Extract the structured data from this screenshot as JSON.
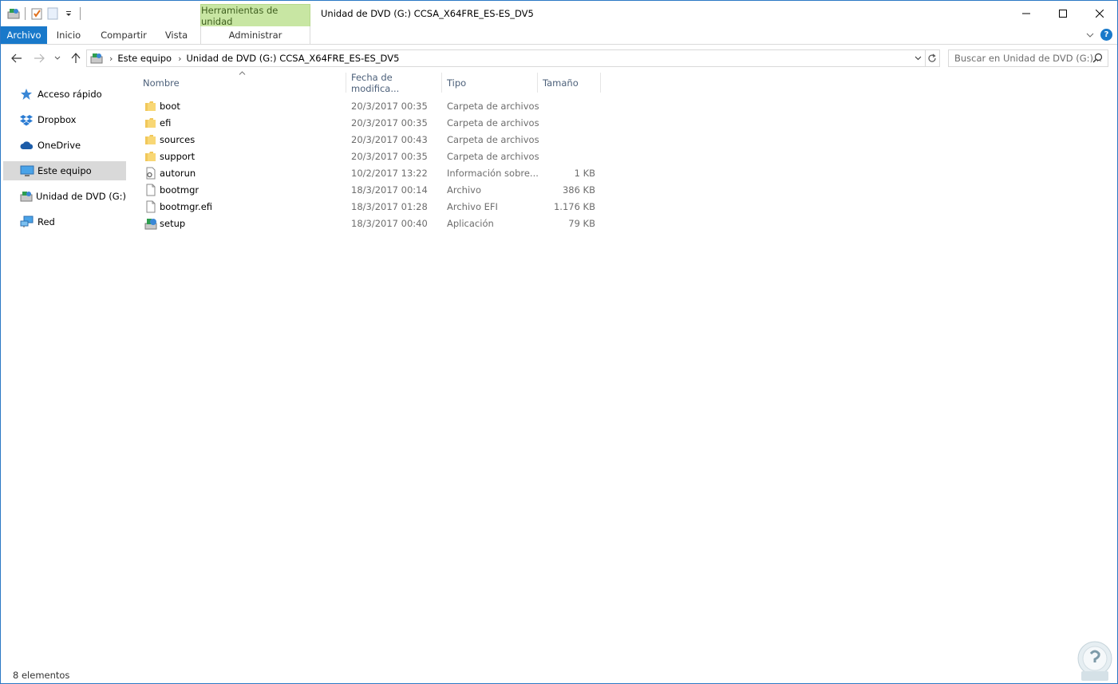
{
  "window": {
    "title": "Unidad de DVD (G:) CCSA_X64FRE_ES-ES_DV5",
    "context_tab_header": "Herramientas de unidad",
    "colors": {
      "accent": "#1979ca",
      "context_tab": "#c8e6a3",
      "selected": "#d9d9d9"
    }
  },
  "ribbon": {
    "tabs": [
      {
        "label": "Archivo"
      },
      {
        "label": "Inicio"
      },
      {
        "label": "Compartir"
      },
      {
        "label": "Vista"
      },
      {
        "label": "Administrar"
      }
    ]
  },
  "address": {
    "crumbs": [
      "Este equipo",
      "Unidad de DVD (G:) CCSA_X64FRE_ES-ES_DV5"
    ],
    "search_placeholder": "Buscar en Unidad de DVD (G:)..."
  },
  "nav": {
    "items": [
      {
        "label": "Acceso rápido",
        "icon": "star-icon"
      },
      {
        "label": "Dropbox",
        "icon": "dropbox-icon"
      },
      {
        "label": "OneDrive",
        "icon": "cloud-icon"
      },
      {
        "label": "Este equipo",
        "icon": "computer-icon",
        "selected": true
      },
      {
        "label": "Unidad de DVD (G:) C",
        "icon": "dvd-drive-icon"
      },
      {
        "label": "Red",
        "icon": "network-icon"
      }
    ]
  },
  "files": {
    "columns": [
      "Nombre",
      "Fecha de modifica...",
      "Tipo",
      "Tamaño"
    ],
    "rows": [
      {
        "name": "boot",
        "date": "20/3/2017 00:35",
        "type": "Carpeta de archivos",
        "size": "",
        "icon": "folder-icon"
      },
      {
        "name": "efi",
        "date": "20/3/2017 00:35",
        "type": "Carpeta de archivos",
        "size": "",
        "icon": "folder-icon"
      },
      {
        "name": "sources",
        "date": "20/3/2017 00:43",
        "type": "Carpeta de archivos",
        "size": "",
        "icon": "folder-icon"
      },
      {
        "name": "support",
        "date": "20/3/2017 00:35",
        "type": "Carpeta de archivos",
        "size": "",
        "icon": "folder-icon"
      },
      {
        "name": "autorun",
        "date": "10/2/2017 13:22",
        "type": "Información sobre...",
        "size": "1 KB",
        "icon": "settings-file-icon"
      },
      {
        "name": "bootmgr",
        "date": "18/3/2017 00:14",
        "type": "Archivo",
        "size": "386 KB",
        "icon": "file-icon"
      },
      {
        "name": "bootmgr.efi",
        "date": "18/3/2017 01:28",
        "type": "Archivo EFI",
        "size": "1.176 KB",
        "icon": "file-icon"
      },
      {
        "name": "setup",
        "date": "18/3/2017 00:40",
        "type": "Aplicación",
        "size": "79 KB",
        "icon": "setup-app-icon"
      }
    ]
  },
  "status": {
    "count": "8 elementos"
  }
}
